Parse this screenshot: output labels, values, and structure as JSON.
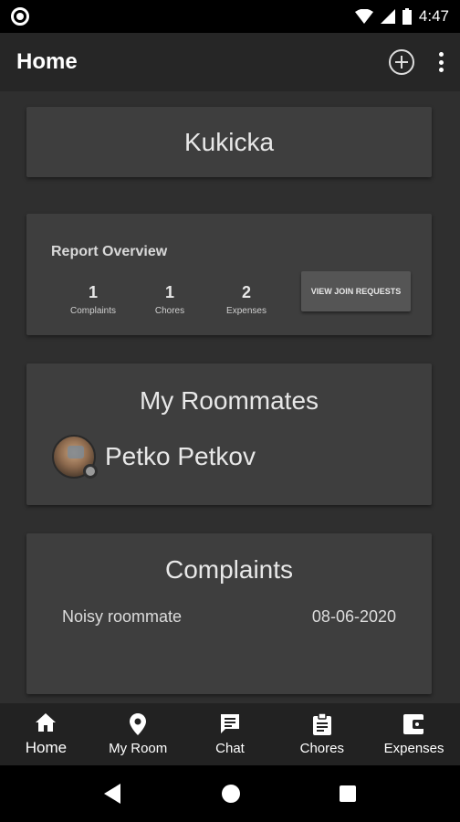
{
  "status_bar": {
    "time": "4:47"
  },
  "app_bar": {
    "title": "Home"
  },
  "room": {
    "name": "Kukicka"
  },
  "report_overview": {
    "title": "Report Overview",
    "stats": [
      {
        "value": "1",
        "label": "Complaints"
      },
      {
        "value": "1",
        "label": "Chores"
      },
      {
        "value": "2",
        "label": "Expenses"
      }
    ],
    "join_button_label": "VIEW JOIN REQUESTS"
  },
  "roommates": {
    "title": "My Roommates",
    "items": [
      {
        "name": "Petko Petkov"
      }
    ]
  },
  "complaints": {
    "title": "Complaints",
    "items": [
      {
        "title": "Noisy roommate",
        "date": "08-06-2020"
      }
    ]
  },
  "bottom_nav": {
    "items": [
      {
        "label": "Home",
        "icon": "home-icon",
        "active": true
      },
      {
        "label": "My Room",
        "icon": "location-pin-icon"
      },
      {
        "label": "Chat",
        "icon": "chat-icon"
      },
      {
        "label": "Chores",
        "icon": "clipboard-icon"
      },
      {
        "label": "Expenses",
        "icon": "wallet-icon"
      }
    ]
  },
  "colors": {
    "background": "#2f2f2f",
    "card": "#3e3e3e",
    "app_bar": "#262626",
    "bottom_nav": "#222222"
  }
}
